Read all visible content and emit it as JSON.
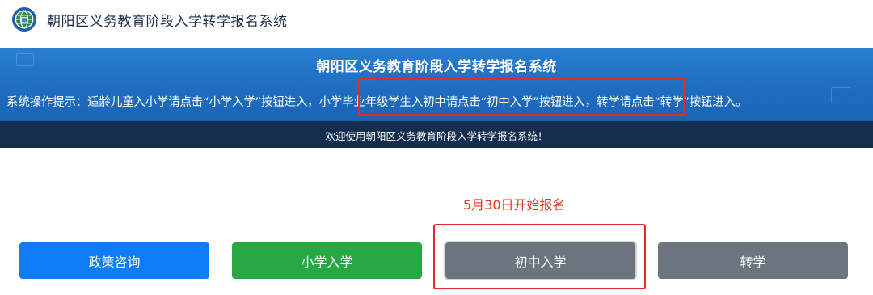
{
  "header": {
    "site_title": "朝阳区义务教育阶段入学转学报名系统",
    "logo_icon": "globe-emblem-icon"
  },
  "banner": {
    "title": "朝阳区义务教育阶段入学转学报名系统",
    "tips_prefix": "系统操作提示：",
    "tip_primary": "适龄儿童入小学请点击“小学入学”按钮进入，",
    "tip_middle": "小学毕业年级学生入初中请点击“初中入学”按钮进入，",
    "tip_transfer": "转学请点击“转学”按钮进入。"
  },
  "welcome": {
    "text": "欢迎使用朝阳区义务教育阶段入学转学报名系统！"
  },
  "registration": {
    "start_text": "5月30日开始报名"
  },
  "buttons": {
    "policy": "政策咨询",
    "primary_school": "小学入学",
    "middle_school": "初中入学",
    "transfer": "转学"
  },
  "colors": {
    "banner_blue": "#1f6fc3",
    "welcome_dark": "#132e4e",
    "policy_blue": "#0d7cf5",
    "primary_green": "#28a745",
    "gray_button": "#6c757d",
    "highlight_red": "#e52a2a",
    "notice_red": "#e8321f"
  }
}
